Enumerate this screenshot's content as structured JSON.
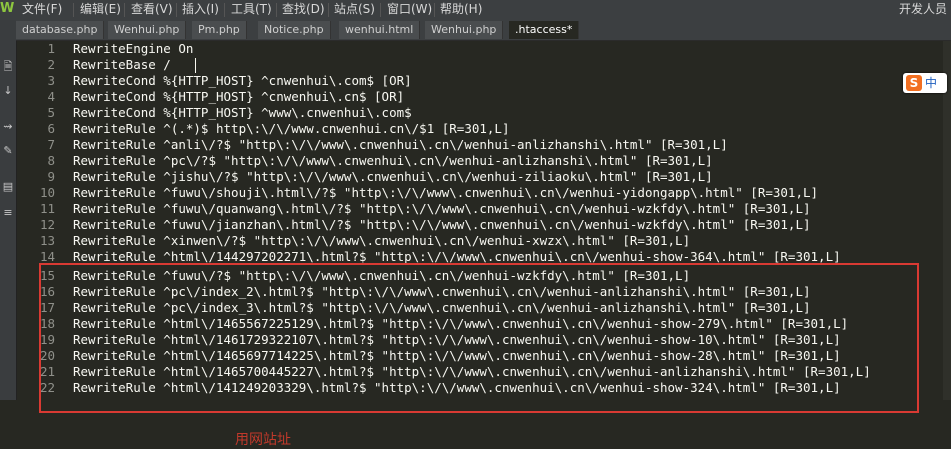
{
  "menubar": {
    "logo": "W",
    "items": [
      "文件(F)",
      "编辑(E)",
      "查看(V)",
      "插入(I)",
      "工具(T)",
      "查找(D)",
      "站点(S)",
      "窗口(W)",
      "帮助(H)"
    ],
    "right_label": "开发人员"
  },
  "tabs": [
    "database.php",
    "Wenhui.php",
    "Pm.php",
    "Notice.php",
    "wenhui.html",
    "Wenhui.php",
    ".htaccess*"
  ],
  "active_tab_index": 6,
  "left_tools": [
    "file-icon",
    "arrow-down-icon",
    "code-tool-icon",
    "pencil-icon",
    "format-icon",
    "settings-icon"
  ],
  "editor": {
    "lines": [
      {
        "n": "1",
        "text": "RewriteEngine On"
      },
      {
        "n": "2",
        "text": "RewriteBase /"
      },
      {
        "n": "3",
        "text": "RewriteCond %{HTTP_HOST} ^cnwenhui\\.com$ [OR]"
      },
      {
        "n": "4",
        "text": "RewriteCond %{HTTP_HOST} ^cnwenhui\\.cn$ [OR]"
      },
      {
        "n": "5",
        "text": "RewriteCond %{HTTP_HOST} ^www\\.cnwenhui\\.com$"
      },
      {
        "n": "6",
        "text": "RewriteRule ^(.*)$ http\\:\\/\\/www.cnwenhui.cn\\/$1 [R=301,L]"
      },
      {
        "n": "7",
        "text": "RewriteRule ^anli\\/?$ \"http\\:\\/\\/www\\.cnwenhui\\.cn\\/wenhui-anlizhanshi\\.html\" [R=301,L]"
      },
      {
        "n": "8",
        "text": "RewriteRule ^pc\\/?$ \"http\\:\\/\\/www\\.cnwenhui\\.cn\\/wenhui-anlizhanshi\\.html\" [R=301,L]"
      },
      {
        "n": "9",
        "text": "RewriteRule ^jishu\\/?$ \"http\\:\\/\\/www\\.cnwenhui\\.cn\\/wenhui-ziliaoku\\.html\" [R=301,L]"
      },
      {
        "n": "10",
        "text": "RewriteRule ^fuwu\\/shouji\\.html\\/?$ \"http\\:\\/\\/www\\.cnwenhui\\.cn\\/wenhui-yidongapp\\.html\" [R=301,L]"
      },
      {
        "n": "11",
        "text": "RewriteRule ^fuwu\\/quanwang\\.html\\/?$ \"http\\:\\/\\/www\\.cnwenhui\\.cn\\/wenhui-wzkfdy\\.html\" [R=301,L]"
      },
      {
        "n": "12",
        "text": "RewriteRule ^fuwu\\/jianzhan\\.html\\/?$ \"http\\:\\/\\/www\\.cnwenhui\\.cn\\/wenhui-wzkfdy\\.html\" [R=301,L]"
      },
      {
        "n": "13",
        "text": "RewriteRule ^xinwen\\/?$ \"http\\:\\/\\/www\\.cnwenhui\\.cn\\/wenhui-xwzx\\.html\" [R=301,L]"
      },
      {
        "n": "14",
        "text": "RewriteRule ^html\\/144297202271\\.html?$ \"http\\:\\/\\/www\\.cnwenhui\\.cn\\/wenhui-show-364\\.html\" [R=301,L]"
      },
      {
        "n": "15",
        "text": "RewriteRule ^fuwu\\/?$ \"http\\:\\/\\/www\\.cnwenhui\\.cn\\/wenhui-wzkfdy\\.html\" [R=301,L]"
      },
      {
        "n": "16",
        "text": "RewriteRule ^pc\\/index_2\\.html?$ \"http\\:\\/\\/www\\.cnwenhui\\.cn\\/wenhui-anlizhanshi\\.html\" [R=301,L]"
      },
      {
        "n": "17",
        "text": "RewriteRule ^pc\\/index_3\\.html?$ \"http\\:\\/\\/www\\.cnwenhui\\.cn\\/wenhui-anlizhanshi\\.html\" [R=301,L]"
      },
      {
        "n": "18",
        "text": "RewriteRule ^html\\/1465567225129\\.html?$ \"http\\:\\/\\/www\\.cnwenhui\\.cn\\/wenhui-show-279\\.html\" [R=301,L]"
      },
      {
        "n": "19",
        "text": "RewriteRule ^html\\/1461729322107\\.html?$ \"http\\:\\/\\/www\\.cnwenhui\\.cn\\/wenhui-show-10\\.html\" [R=301,L]"
      },
      {
        "n": "20",
        "text": "RewriteRule ^html\\/1465697714225\\.html?$ \"http\\:\\/\\/www\\.cnwenhui\\.cn\\/wenhui-show-28\\.html\" [R=301,L]"
      },
      {
        "n": "21",
        "text": "RewriteRule ^html\\/1465700445227\\.html?$ \"http\\:\\/\\/www\\.cnwenhui\\.cn\\/wenhui-anlizhanshi\\.html\" [R=301,L]"
      },
      {
        "n": "22",
        "text": "RewriteRule ^html\\/141249203329\\.html?$ \"http\\:\\/\\/www\\.cnwenhui\\.cn\\/wenhui-show-324\\.html\" [R=301,L]"
      }
    ],
    "bottom_note": "用网站址"
  },
  "ime": {
    "logo": "S",
    "label": "中"
  },
  "colors": {
    "editor_bg": "#272822",
    "highlight_border": "#d93a33",
    "line_number": "#8f908a",
    "text": "#f8f8f2"
  }
}
